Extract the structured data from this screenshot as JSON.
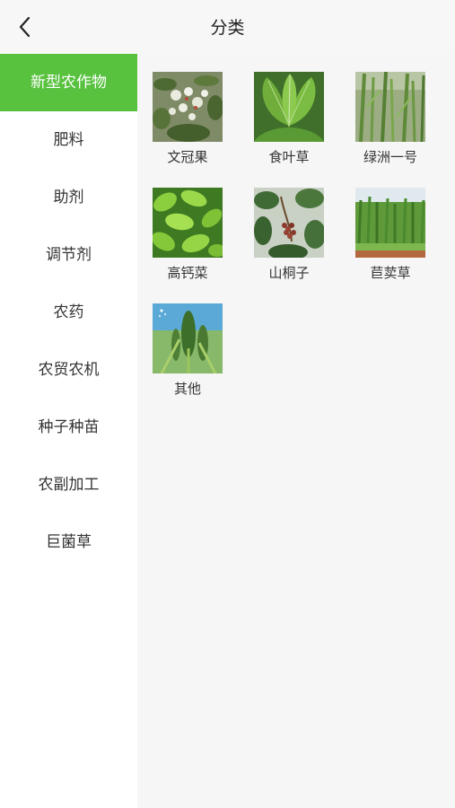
{
  "header": {
    "title": "分类",
    "back_icon": "chevron-left-icon"
  },
  "sidebar": {
    "active_index": 0,
    "accent_color": "#58c23f",
    "items": [
      {
        "label": "新型农作物"
      },
      {
        "label": "肥料"
      },
      {
        "label": "助剂"
      },
      {
        "label": "调节剂"
      },
      {
        "label": "农药"
      },
      {
        "label": "农贸农机"
      },
      {
        "label": "种子种苗"
      },
      {
        "label": "农副加工"
      },
      {
        "label": "巨菌草"
      }
    ]
  },
  "grid": {
    "items": [
      {
        "label": "文冠果"
      },
      {
        "label": "食叶草"
      },
      {
        "label": "绿洲一号"
      },
      {
        "label": "高钙菜"
      },
      {
        "label": "山桐子"
      },
      {
        "label": "苣荬草"
      },
      {
        "label": "其他"
      }
    ]
  }
}
